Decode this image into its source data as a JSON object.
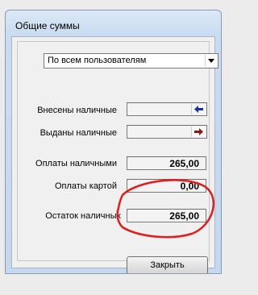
{
  "window": {
    "title": "Общие суммы"
  },
  "filter": {
    "selected": "По всем пользователям"
  },
  "rows": {
    "cash_in": {
      "label": "Внесены наличные",
      "value": ""
    },
    "cash_out": {
      "label": "Выданы наличные",
      "value": ""
    },
    "cash_payments": {
      "label": "Оплаты наличными",
      "value": "265,00"
    },
    "card_payments": {
      "label": "Оплаты картой",
      "value": "0,00"
    },
    "cash_balance": {
      "label": "Остаток наличных",
      "value": "265,00"
    }
  },
  "buttons": {
    "close_label": "Закрыть"
  },
  "colors": {
    "cash_in_arrow": "#1a2fb0",
    "cash_out_arrow": "#8c1a1a",
    "annotation": "#e21b1b"
  },
  "icons": {
    "cash_in": "arrow-left-icon",
    "cash_out": "arrow-right-icon",
    "dropdown": "chevron-down-icon"
  }
}
